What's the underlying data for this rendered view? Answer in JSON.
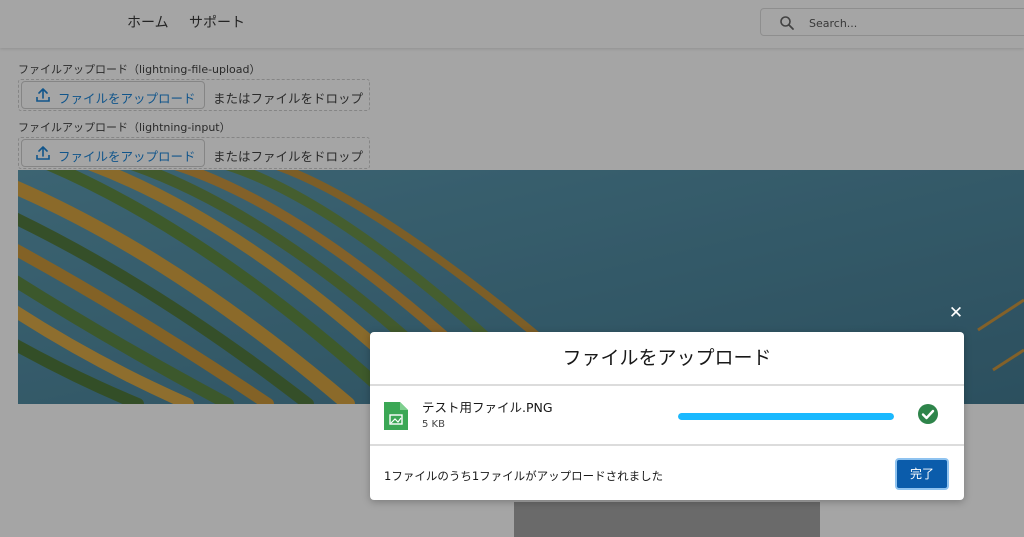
{
  "header": {
    "nav": [
      "ホーム",
      "サポート"
    ],
    "search": {
      "placeholder": "Search..."
    }
  },
  "file_upload_1": {
    "label": "ファイルアップロード（lightning-file-upload）",
    "button_label": "ファイルをアップロード",
    "drop_text": "またはファイルをドロップ"
  },
  "file_upload_2": {
    "label": "ファイルアップロード（lightning-input）",
    "button_label": "ファイルをアップロード",
    "drop_text": "またはファイルをドロップ"
  },
  "modal": {
    "title": "ファイルをアップロード",
    "close_label": "✕",
    "file": {
      "name": "テスト用ファイル.PNG",
      "size": "5 KB",
      "progress": 1.0,
      "status_icon": "check-circle-icon"
    },
    "footer_text": "1ファイルのうち1ファイルがアップロードされました",
    "done_label": "完了"
  },
  "colors": {
    "brand": "#0176d3",
    "progress": "#1ab9ff",
    "success": "#2e844a",
    "done_button": "#0b5cab",
    "file_icon": "#3ba755"
  }
}
